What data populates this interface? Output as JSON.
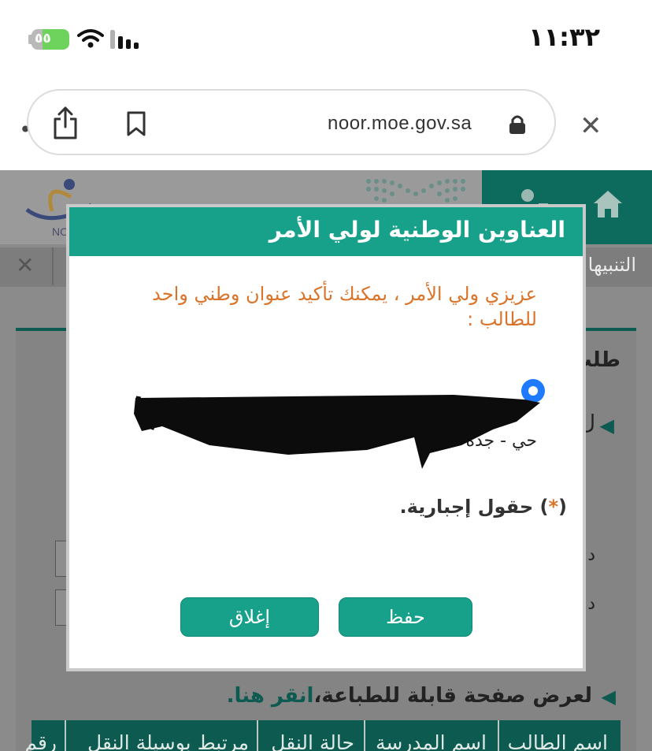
{
  "status_bar": {
    "time": "١١:٣٢",
    "battery_label": "٥٥"
  },
  "browser": {
    "url": "noor.moe.gov.sa"
  },
  "background_page": {
    "brand_fragment": "NO",
    "tab_label": "التنبيها",
    "panel_title": "طلب",
    "row_fragment": "ل",
    "side_char_1": "د",
    "side_char_2": "د",
    "print_text": "لعرض صفحة قابلة للطباعة،",
    "print_link": "انقر هنا.",
    "table_headers": [
      "اسم الطالب",
      "اسم المدرسة",
      "حالة النقل",
      "مرتبط بوسيلة النقل",
      "رقم"
    ]
  },
  "modal": {
    "title": "العناوين الوطنية لولي الأمر",
    "message": "عزيزي ولي الأمر ، يمكنك تأكيد عنوان وطني واحد للطالب :",
    "address_line_1": "",
    "address_line_2": "حي         -  جدة  -  4",
    "required_note_prefix": "(",
    "required_star": "*",
    "required_note_suffix": ") حقول إجبارية.",
    "save_button": "حفظ",
    "close_button": "إغلاق"
  },
  "colors": {
    "modal_header": "#17a08a",
    "message_text": "#d9742a",
    "radio_selected": "#1e7bff"
  }
}
